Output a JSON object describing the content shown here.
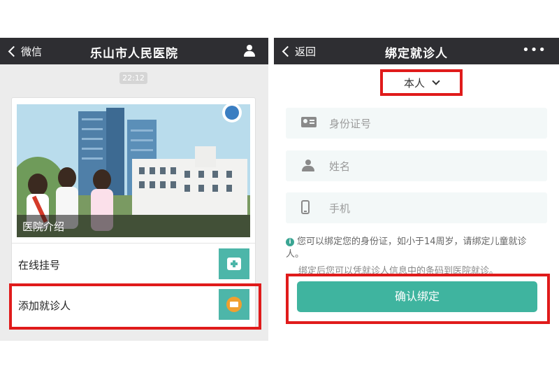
{
  "left_phone": {
    "nav": {
      "back_label": "微信",
      "title": "乐山市人民医院",
      "user_icon": "user-icon"
    },
    "timestamp": "22:12",
    "card": {
      "banner_caption": "医院介绍",
      "menu": [
        {
          "label": "在线挂号",
          "icon": "first-aid-icon"
        },
        {
          "label": "添加就诊人",
          "icon": "id-badge-icon"
        }
      ]
    }
  },
  "right_phone": {
    "nav": {
      "back_label": "返回",
      "title": "绑定就诊人",
      "more_icon": "•••"
    },
    "selector": {
      "value": "本人"
    },
    "fields": [
      {
        "placeholder": "身份证号",
        "icon": "id-card-icon"
      },
      {
        "placeholder": "姓名",
        "icon": "person-icon"
      },
      {
        "placeholder": "手机",
        "icon": "phone-icon"
      }
    ],
    "notice": {
      "icon_glyph": "i",
      "text": "您可以绑定您的身份证，如小于14周岁，请绑定儿童就诊人。",
      "text2": "绑定后您可以凭就诊人信息中的条码到医院就诊。"
    },
    "confirm_label": "确认绑定"
  },
  "colors": {
    "nav_bg": "#2e2e32",
    "accent": "#3fb49f",
    "highlight": "#e01b1b",
    "tile": "#4db6a9"
  }
}
